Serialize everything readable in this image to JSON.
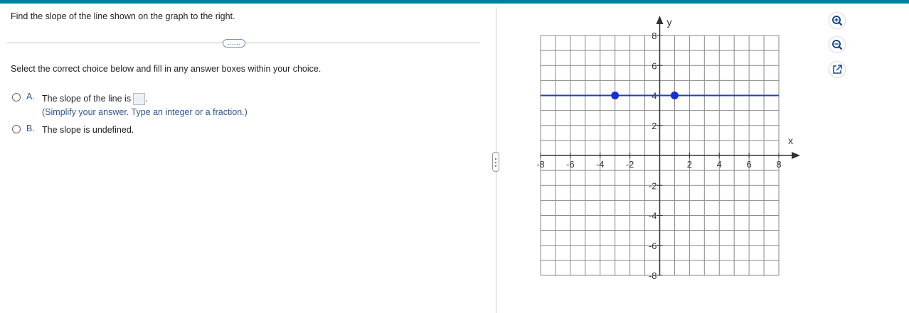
{
  "question": "Find the slope of the line shown on the graph to the right.",
  "expander_label": "……",
  "instruction": "Select the correct choice below and fill in any answer boxes within your choice.",
  "choices": [
    {
      "letter": "A.",
      "text": "The slope of the line is",
      "suffix": ".",
      "hint": "(Simplify your answer. Type an integer or a fraction.)"
    },
    {
      "letter": "B.",
      "text": "The slope is undefined."
    }
  ],
  "graph": {
    "x_axis_label": "x",
    "y_axis_label": "y",
    "x_ticks": [
      "-8",
      "-6",
      "-4",
      "-2",
      "2",
      "4",
      "6",
      "8"
    ],
    "y_ticks": [
      "8",
      "6",
      "4",
      "2",
      "-2",
      "-4",
      "-6",
      "-8"
    ],
    "line_color": "#1f3fbf",
    "point_color": "#1430d6"
  },
  "chart_data": {
    "type": "line",
    "xlim": [
      -8,
      8
    ],
    "ylim": [
      -8,
      8
    ],
    "grid": true,
    "series": [
      {
        "x": [
          -8,
          8
        ],
        "y": [
          4,
          4
        ]
      }
    ],
    "points": [
      {
        "x": -3,
        "y": 4
      },
      {
        "x": 1,
        "y": 4
      }
    ]
  },
  "tools": [
    {
      "name": "zoom-in-icon"
    },
    {
      "name": "zoom-out-icon"
    },
    {
      "name": "pop-out-icon"
    }
  ]
}
